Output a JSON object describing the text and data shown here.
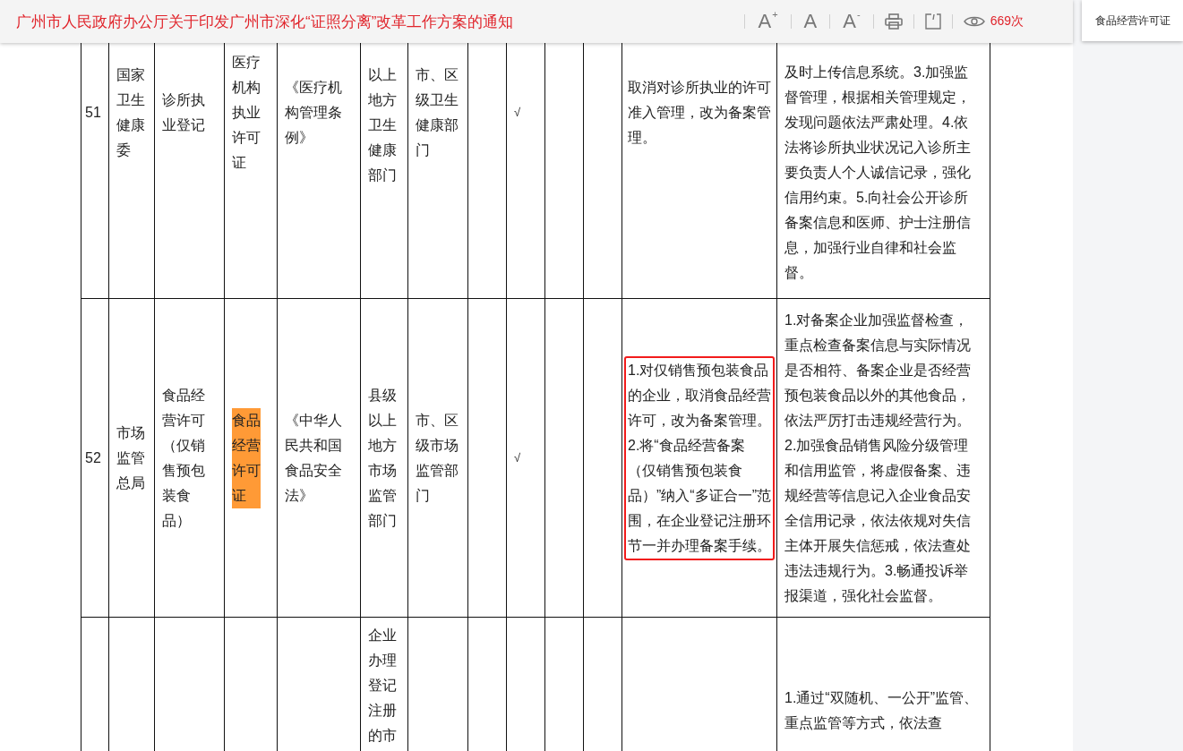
{
  "header": {
    "title": "广州市人民政府办公厅关于印发广州市深化“证照分离”改革工作方案的通知",
    "font_controls": [
      {
        "label": "A",
        "sign": "+"
      },
      {
        "label": "A"
      },
      {
        "label": "A",
        "sign": "-"
      }
    ],
    "views": "669次"
  },
  "search_popup": {
    "text": "食品经营许可证"
  },
  "rows": [
    {
      "cells": [
        {
          "text": "51",
          "highlighted": false,
          "outlined": false
        },
        {
          "text": "国家卫生健康委",
          "highlighted": false,
          "outlined": false
        },
        {
          "text": "诊所执业登记",
          "highlighted": false,
          "outlined": false
        },
        {
          "text": "医疗机构执业许可证",
          "highlighted": false,
          "outlined": false
        },
        {
          "text": "《医疗机构管理条例》",
          "highlighted": false,
          "outlined": false
        },
        {
          "text": "以上地方卫生健康部门",
          "highlighted": false,
          "outlined": false
        },
        {
          "text": "市、区级卫生健康部门",
          "highlighted": false,
          "outlined": false
        },
        {
          "highlighted": false,
          "outlined": false
        },
        {
          "text": "√",
          "highlighted": false,
          "outlined": false
        },
        {
          "highlighted": false,
          "outlined": false
        },
        {
          "highlighted": false,
          "outlined": false
        },
        {
          "text": "取消对诊所执业的许可准入管理，改为备案管理。",
          "highlighted": false,
          "outlined": false
        },
        {
          "text": "及时上传信息系统。3.加强监督管理，根据相关管理规定，发现问题依法严肃处理。4.依法将诊所执业状况记入诊所主要负责人个人诚信记录，强化信用约束。5.向社会公开诊所备案信息和医师、护士注册信息，加强行业自律和社会监督。",
          "highlighted": false,
          "outlined": false
        }
      ]
    },
    {
      "cells": [
        {
          "text": "52",
          "highlighted": false,
          "outlined": false
        },
        {
          "text": "市场监管总局",
          "highlighted": false,
          "outlined": false
        },
        {
          "text": "食品经营许可（仅销售预包装食品）",
          "highlighted": false,
          "outlined": false
        },
        {
          "text": "食品经营许可证",
          "highlighted": true,
          "outlined": false
        },
        {
          "text": "《中华人民共和国食品安全法》",
          "highlighted": false,
          "outlined": false
        },
        {
          "text": "县级以上地方市场监管部门",
          "highlighted": false,
          "outlined": false
        },
        {
          "text": "市、区级市场监管部门",
          "highlighted": false,
          "outlined": false
        },
        {
          "highlighted": false,
          "outlined": false
        },
        {
          "text": "√",
          "highlighted": false,
          "outlined": false
        },
        {
          "highlighted": false,
          "outlined": false
        },
        {
          "highlighted": false,
          "outlined": false
        },
        {
          "text": "1.对仅销售预包装食品的企业，取消食品经营许可，改为备案管理。2.将“食品经营备案（仅销售预包装食品）”纳入“多证合一”范围，在企业登记注册环节一并办理备案手续。",
          "highlighted": false,
          "outlined": true
        },
        {
          "text": "1.对备案企业加强监督检查，重点检查备案信息与实际情况是否相符、备案企业是否经营预包装食品以外的其他食品，依法严厉打击违规经营行为。2.加强食品销售风险分级管理和信用监管，将虚假备案、违规经营等信息记入企业食品安全信用记录，依法依规对失信主体开展失信惩戒，依法查处违法违规行为。3.畅通投诉举报渠道，强化社会监督。",
          "highlighted": false,
          "outlined": false
        }
      ]
    },
    {
      "cells": [
        {
          "highlighted": false,
          "outlined": false
        },
        {
          "highlighted": false,
          "outlined": false
        },
        {
          "highlighted": false,
          "outlined": false
        },
        {
          "highlighted": false,
          "outlined": false
        },
        {
          "highlighted": false,
          "outlined": false
        },
        {
          "text": "企业办理登记注册的市",
          "highlighted": false,
          "outlined": false
        },
        {
          "highlighted": false,
          "outlined": false
        },
        {
          "highlighted": false,
          "outlined": false
        },
        {
          "highlighted": false,
          "outlined": false
        },
        {
          "highlighted": false,
          "outlined": false
        },
        {
          "highlighted": false,
          "outlined": false
        },
        {
          "highlighted": false,
          "outlined": false
        },
        {
          "text": "1.通过“双随机、一公开”监管、重点监管等方式，依法查",
          "highlighted": false,
          "outlined": false
        }
      ]
    }
  ]
}
